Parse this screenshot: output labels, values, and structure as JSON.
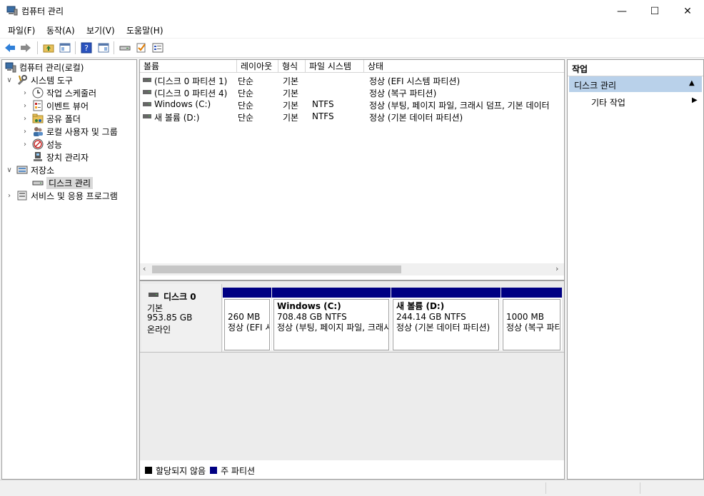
{
  "window": {
    "title": "컴퓨터 관리",
    "minimize": "—",
    "maximize": "☐",
    "close": "✕"
  },
  "menu": [
    "파일(F)",
    "동작(A)",
    "보기(V)",
    "도움말(H)"
  ],
  "tree": {
    "root": "컴퓨터 관리(로컬)",
    "system_tools": "시스템 도구",
    "task_scheduler": "작업 스케줄러",
    "event_viewer": "이벤트 뷰어",
    "shared_folders": "공유 폴더",
    "local_users": "로컬 사용자 및 그룹",
    "performance": "성능",
    "device_manager": "장치 관리자",
    "storage": "저장소",
    "disk_management": "디스크 관리",
    "services_apps": "서비스 및 응용 프로그램"
  },
  "volumes": {
    "headers": {
      "volume": "볼륨",
      "layout": "레이아웃",
      "type": "형식",
      "fs": "파일 시스템",
      "status": "상태"
    },
    "rows": [
      {
        "volume": "(디스크 0 파티션 1)",
        "layout": "단순",
        "type": "기본",
        "fs": "",
        "status": "정상 (EFI 시스템 파티션)"
      },
      {
        "volume": "(디스크 0 파티션 4)",
        "layout": "단순",
        "type": "기본",
        "fs": "",
        "status": "정상 (복구 파티션)"
      },
      {
        "volume": "Windows (C:)",
        "layout": "단순",
        "type": "기본",
        "fs": "NTFS",
        "status": "정상 (부팅, 페이지 파일, 크래시 덤프, 기본 데이터"
      },
      {
        "volume": "새 볼륨 (D:)",
        "layout": "단순",
        "type": "기본",
        "fs": "NTFS",
        "status": "정상 (기본 데이터 파티션)"
      }
    ]
  },
  "disk": {
    "name": "디스크 0",
    "type": "기본",
    "size": "953.85 GB",
    "state": "온라인",
    "partitions": [
      {
        "title": "",
        "size": "260 MB",
        "status": "정상 (EFI 시스템 파티션)"
      },
      {
        "title": "Windows  (C:)",
        "size": "708.48 GB NTFS",
        "status": "정상 (부팅, 페이지 파일, 크래시 덤프, 기본 데이터 파티션)"
      },
      {
        "title": "새 볼륨  (D:)",
        "size": "244.14 GB NTFS",
        "status": "정상 (기본 데이터 파티션)"
      },
      {
        "title": "",
        "size": "1000 MB",
        "status": "정상 (복구 파티션)"
      }
    ]
  },
  "legend": {
    "unallocated": "할당되지 않음",
    "primary": "주 파티션"
  },
  "actions": {
    "header": "작업",
    "section": "디스크 관리",
    "more": "기타 작업"
  },
  "colors": {
    "primary_partition": "#000083",
    "selected_section": "#b9d1ea"
  }
}
